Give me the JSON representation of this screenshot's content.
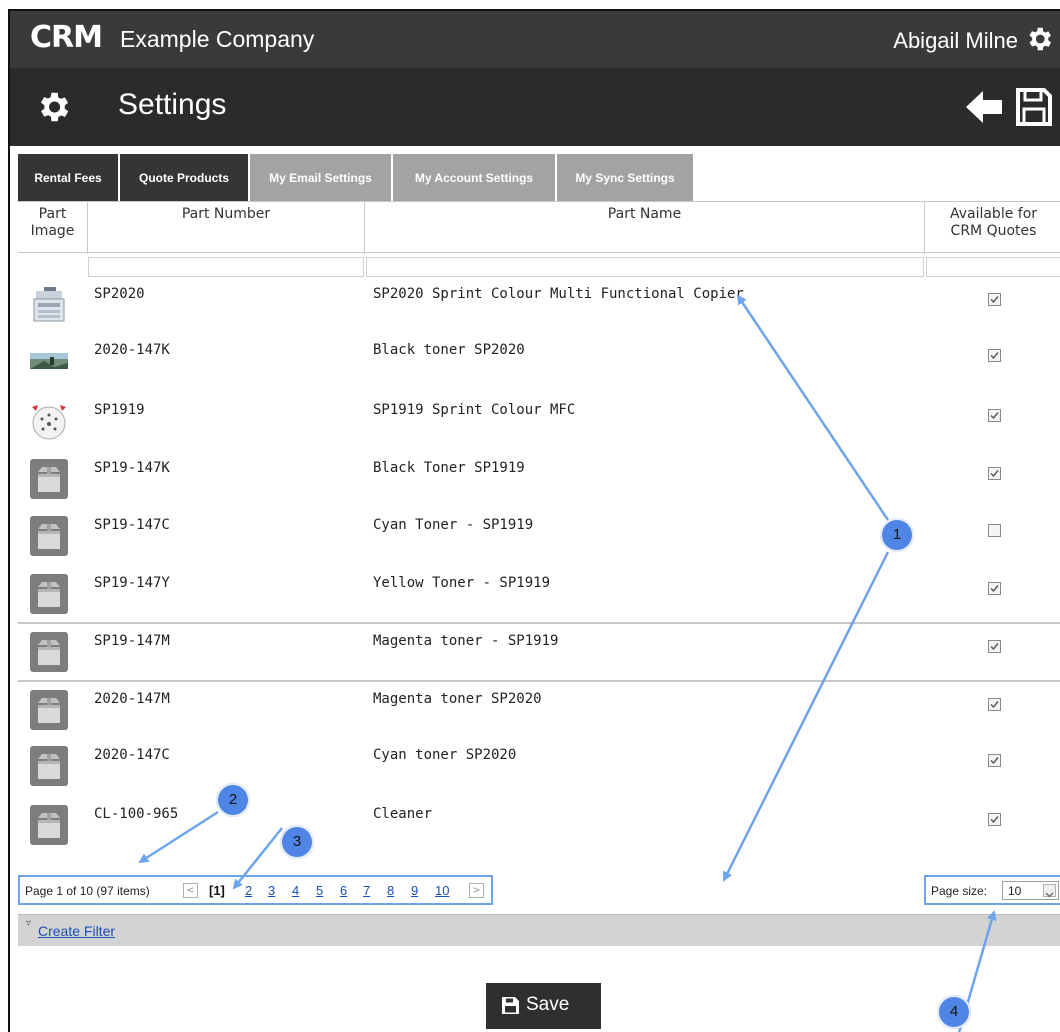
{
  "app": {
    "logo": "CRM",
    "company": "Example Company",
    "user": "Abigail Milne",
    "page_title": "Settings"
  },
  "tabs": [
    {
      "label": "Rental Fees",
      "active": true
    },
    {
      "label": "Quote Products",
      "active": true
    },
    {
      "label": "My Email Settings",
      "active": false
    },
    {
      "label": "My Account Settings",
      "active": false
    },
    {
      "label": "My Sync Settings",
      "active": false
    }
  ],
  "grid": {
    "headers": {
      "image": "Part Image",
      "number": "Part Number",
      "name": "Part Name",
      "available": "Available for CRM Quotes"
    },
    "rows": [
      {
        "thumb": "copier-image",
        "number": "SP2020",
        "name": "SP2020 Sprint Colour Multi Functional Copier",
        "available": true
      },
      {
        "thumb": "photo-image",
        "number": "2020-147K",
        "name": "Black toner SP2020",
        "available": true
      },
      {
        "thumb": "round-image",
        "number": "SP1919",
        "name": "SP1919 Sprint Colour MFC",
        "available": true
      },
      {
        "thumb": "placeholder-image",
        "number": "SP19-147K",
        "name": "Black Toner SP1919",
        "available": true
      },
      {
        "thumb": "placeholder-image",
        "number": "SP19-147C",
        "name": "Cyan Toner - SP1919",
        "available": false
      },
      {
        "thumb": "placeholder-image",
        "number": "SP19-147Y",
        "name": "Yellow Toner - SP1919",
        "available": true
      },
      {
        "thumb": "placeholder-image",
        "number": "SP19-147M",
        "name": "Magenta toner - SP1919",
        "available": true
      },
      {
        "thumb": "placeholder-image",
        "number": "2020-147M",
        "name": "Magenta toner SP2020",
        "available": true
      },
      {
        "thumb": "placeholder-image",
        "number": "2020-147C",
        "name": "Cyan toner SP2020",
        "available": true
      },
      {
        "thumb": "placeholder-image",
        "number": "CL-100-965",
        "name": "Cleaner",
        "available": true
      }
    ]
  },
  "pager": {
    "info": "Page 1 of 10 (97 items)",
    "pages": [
      "[1]",
      "2",
      "3",
      "4",
      "5",
      "6",
      "7",
      "8",
      "9",
      "10"
    ],
    "prev": "<",
    "next": ">",
    "page_size_label": "Page size:",
    "page_size_value": "10"
  },
  "filter": {
    "link": "Create Filter"
  },
  "save_button": {
    "label": "Save"
  },
  "callouts": [
    "1",
    "2",
    "3",
    "4"
  ],
  "colors": {
    "header_bg": "#3a3a3a",
    "title_bg": "#2b2b2b",
    "highlight": "#6ea4ec",
    "callout": "#4f86e6",
    "link": "#1a4fb5"
  }
}
